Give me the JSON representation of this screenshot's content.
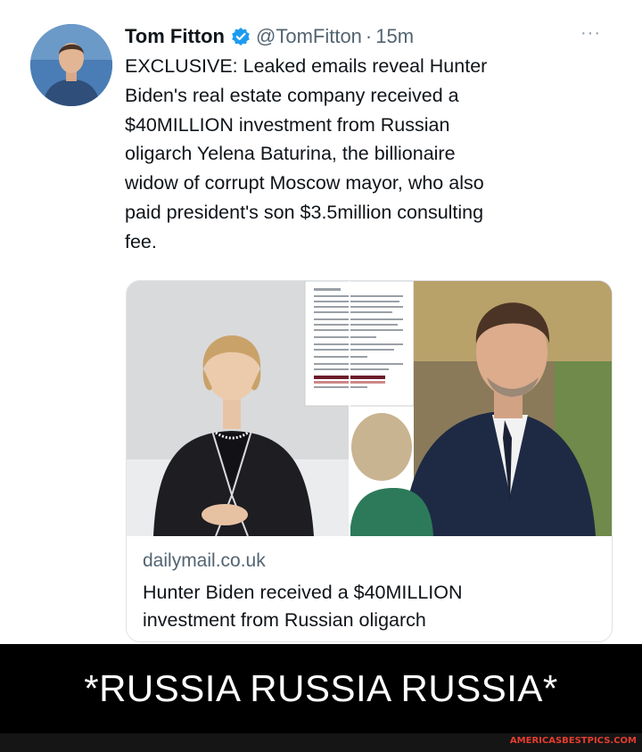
{
  "tweet": {
    "author_name": "Tom Fitton",
    "handle": "@TomFitton",
    "separator": "·",
    "time": "15m",
    "more_icon": "more-icon",
    "verified_icon": "verified-badge-icon",
    "text_lines": [
      "EXCLUSIVE: Leaked emails reveal Hunter",
      "Biden's real estate company received a",
      "$40MILLION investment from Russian",
      "oligarch Yelena Baturina, the billionaire",
      "widow of corrupt Moscow mayor, who also",
      "paid president's son $3.5million consulting",
      "fee."
    ]
  },
  "link_card": {
    "domain": "dailymail.co.uk",
    "title_lines": [
      "Hunter Biden received a $40MILLION",
      "investment from Russian oligarch"
    ]
  },
  "meme": {
    "caption": "*RUSSIA RUSSIA RUSSIA*",
    "watermark": "AMERICASBESTPICS.COM"
  },
  "colors": {
    "verified": "#1d9bf0",
    "secondary_text": "#536471",
    "watermark": "#e53d2f"
  }
}
